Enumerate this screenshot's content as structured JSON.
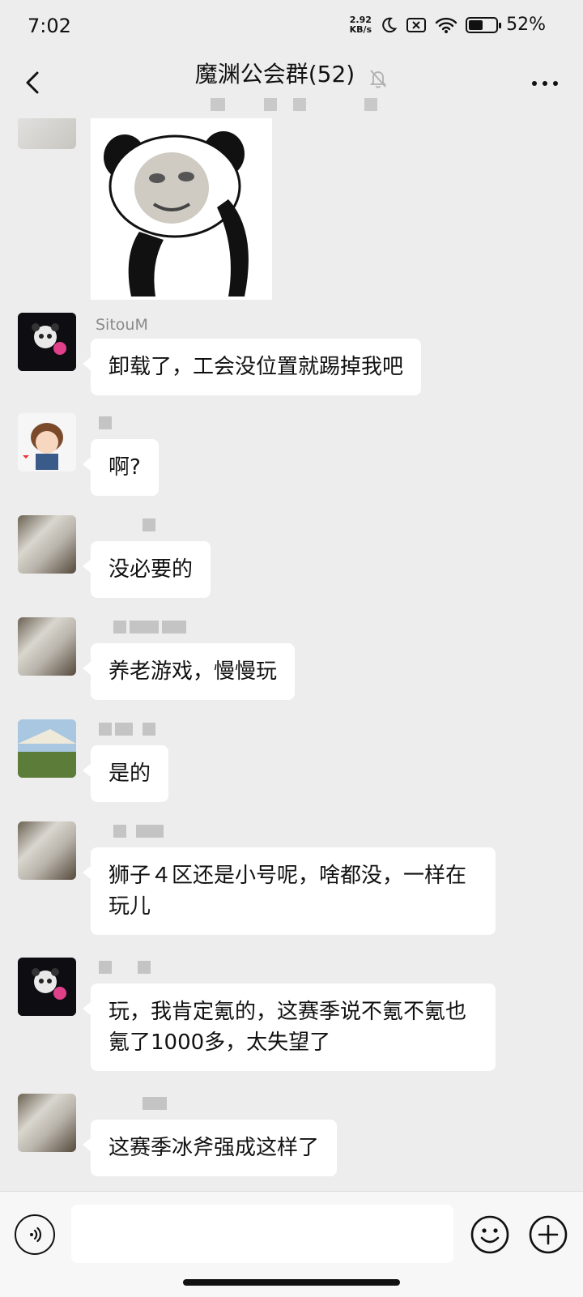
{
  "status_bar": {
    "time": "7:02",
    "net_speed_value": "2.92",
    "net_speed_unit": "KB/s",
    "battery": "52%",
    "battery_level": 0.52
  },
  "header": {
    "title": "魔渊公会群(52)"
  },
  "messages": [
    {
      "nick": "",
      "text": ""
    },
    {
      "nick": "SitouM",
      "text": "卸载了，工会没位置就踢掉我吧"
    },
    {
      "nick": "",
      "text": "啊?"
    },
    {
      "nick": "",
      "text": "没必要的"
    },
    {
      "nick": "",
      "text": "养老游戏，慢慢玩"
    },
    {
      "nick": "",
      "text": "是的"
    },
    {
      "nick": "",
      "text": "狮子４区还是小号呢，啥都没，一样在玩儿"
    },
    {
      "nick": "",
      "text": "玩，我肯定氪的，这赛季说不氪不氪也氪了1000多，太失望了"
    },
    {
      "nick": "",
      "text": "这赛季冰斧强成这样了"
    }
  ],
  "icons": {
    "back": "chevron-left-icon",
    "mute": "bell-off-icon",
    "more": "more-dots-icon",
    "voice": "voice-icon",
    "emoji": "emoji-icon",
    "plus": "plus-icon"
  }
}
